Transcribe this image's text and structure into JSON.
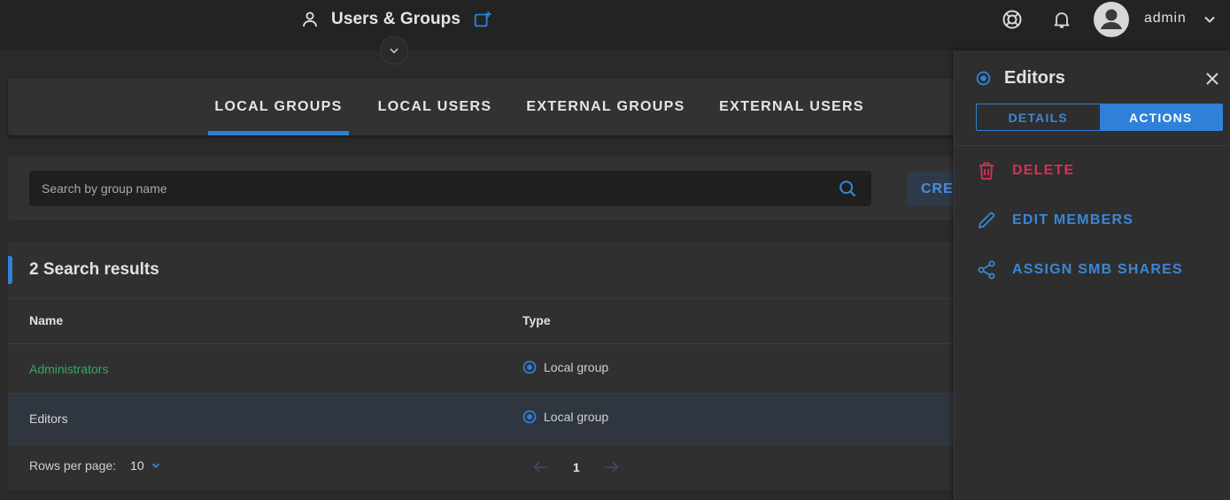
{
  "header": {
    "title": "Users & Groups",
    "username": "admin"
  },
  "tabs": [
    {
      "label": "LOCAL GROUPS",
      "active": true
    },
    {
      "label": "LOCAL USERS",
      "active": false
    },
    {
      "label": "EXTERNAL GROUPS",
      "active": false
    },
    {
      "label": "EXTERNAL USERS",
      "active": false
    }
  ],
  "search": {
    "placeholder": "Search by group name",
    "value": "",
    "create_label": "CREA"
  },
  "results": {
    "title": "2 Search results",
    "columns": [
      "Name",
      "Type"
    ],
    "rows": [
      {
        "name": "Administrators",
        "type": "Local group",
        "selected": false
      },
      {
        "name": "Editors",
        "type": "Local group",
        "selected": true
      }
    ],
    "rows_per_page_label": "Rows per page:",
    "rows_per_page": "10",
    "page": "1"
  },
  "side_panel": {
    "title": "Editors",
    "segments": [
      {
        "label": "DETAILS",
        "active": false
      },
      {
        "label": "ACTIONS",
        "active": true
      }
    ],
    "actions": [
      {
        "label": "DELETE",
        "icon": "trash-icon",
        "color": "#d6314f"
      },
      {
        "label": "EDIT MEMBERS",
        "icon": "pencil-icon",
        "color": "#3b86d6"
      },
      {
        "label": "ASSIGN SMB SHARES",
        "icon": "share-icon",
        "color": "#3b86d6"
      }
    ]
  },
  "colors": {
    "accent": "#2f80d9",
    "link_green": "#3aa56a",
    "danger": "#d6314f",
    "background": "#2a2a2a"
  }
}
